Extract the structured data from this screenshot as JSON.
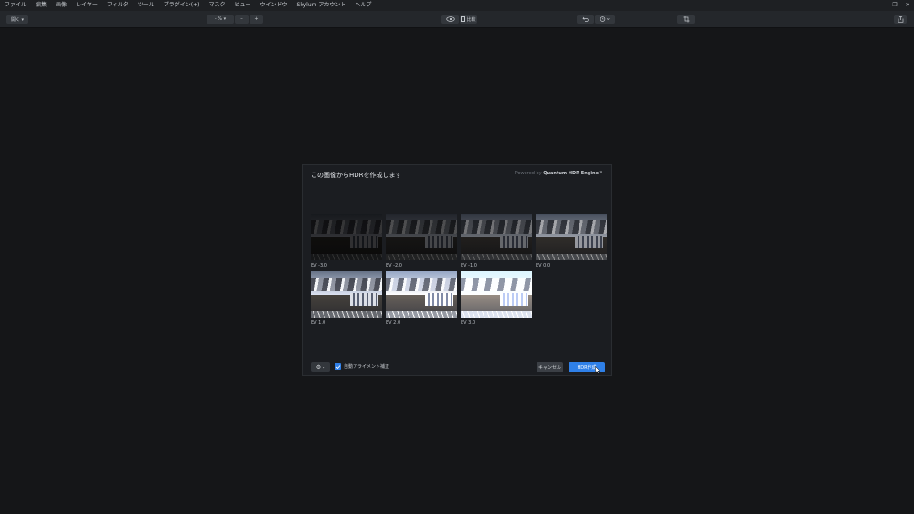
{
  "menu": {
    "items": [
      "ファイル",
      "編集",
      "画像",
      "レイヤー",
      "フィルタ",
      "ツール",
      "プラグイン(+)",
      "マスク",
      "ビュー",
      "ウインドウ",
      "Skylum アカウント",
      "ヘルプ"
    ]
  },
  "window_controls": {
    "minimize": "–",
    "restore": "❐",
    "close": "✕"
  },
  "toolbar": {
    "open_label": "開く ▾",
    "zoom_label": "- % ▾",
    "zoom_out": "–",
    "zoom_in": "+",
    "compare_label": "比較"
  },
  "dialog": {
    "title": "この画像からHDRを作成します",
    "powered_prefix": "Powered by",
    "powered_engine": "Quantum HDR Engine™",
    "images": [
      {
        "label": "EV -3.0",
        "exposure": -3.0
      },
      {
        "label": "EV -2.0",
        "exposure": -2.0
      },
      {
        "label": "EV -1.0",
        "exposure": -1.0
      },
      {
        "label": "EV 0.0",
        "exposure": 0.0
      },
      {
        "label": "EV 1.0",
        "exposure": 1.0
      },
      {
        "label": "EV 2.0",
        "exposure": 2.0
      },
      {
        "label": "EV 3.0",
        "exposure": 3.0
      }
    ],
    "auto_align_label": "自動アライメント補正",
    "auto_align_checked": true,
    "cancel_label": "キャンセル",
    "create_label": "HDR作成"
  },
  "colors": {
    "accent": "#2f80e8",
    "background": "#151618",
    "dialog": "#1b1d21"
  }
}
